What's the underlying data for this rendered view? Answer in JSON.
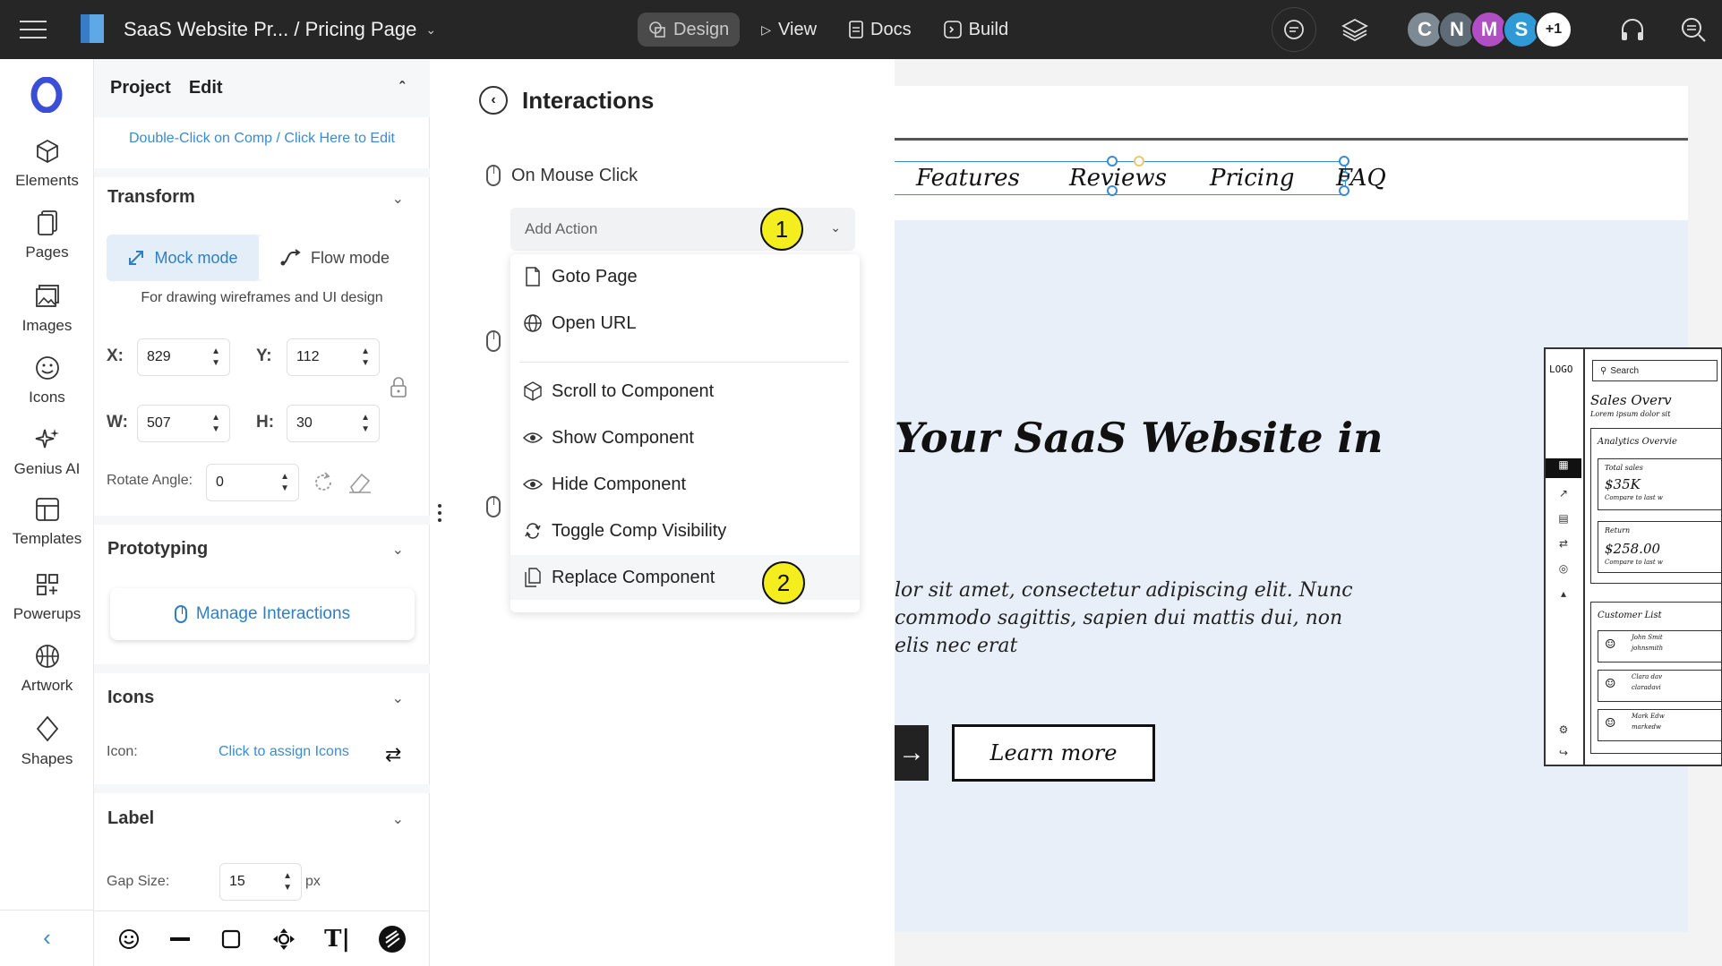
{
  "topbar": {
    "breadcrumb": "SaaS Website Pr... / Pricing Page",
    "nav": [
      "Design",
      "View",
      "Docs",
      "Build"
    ],
    "avatars": [
      {
        "letter": "C",
        "color": "#7d8a94"
      },
      {
        "letter": "N",
        "color": "#5f6b76"
      },
      {
        "letter": "M",
        "color": "#b04ec4"
      },
      {
        "letter": "S",
        "color": "#2f9ad6"
      }
    ],
    "avatar_more": "+1"
  },
  "rail": {
    "items": [
      "Elements",
      "Pages",
      "Images",
      "Icons",
      "Genius AI",
      "Templates",
      "Powerups",
      "Artwork",
      "Shapes"
    ]
  },
  "props": {
    "tabs": [
      "Project",
      "Edit"
    ],
    "hint": "Double-Click on Comp / Click Here to Edit",
    "transform": {
      "title": "Transform",
      "mock_mode": "Mock mode",
      "flow_mode": "Flow mode",
      "mode_desc": "For drawing wireframes and UI design",
      "x_label": "X:",
      "x": "829",
      "y_label": "Y:",
      "y": "112",
      "w_label": "W:",
      "w": "507",
      "h_label": "H:",
      "h": "30",
      "rotate_label": "Rotate Angle:",
      "rotate": "0"
    },
    "prototyping": {
      "title": "Prototyping",
      "manage": "Manage Interactions"
    },
    "icons": {
      "title": "Icons",
      "icon_label": "Icon:",
      "assign": "Click to assign Icons"
    },
    "label": {
      "title": "Label",
      "gap_label": "Gap Size:",
      "gap": "15",
      "unit": "px"
    }
  },
  "interactions": {
    "title": "Interactions",
    "event": "On Mouse Click",
    "add_action": "Add Action",
    "badge1": "1",
    "badge2": "2",
    "menu": [
      {
        "label": "Goto Page",
        "icon": "page-icon"
      },
      {
        "label": "Open URL",
        "icon": "globe-icon"
      },
      {
        "label": "Scroll to Component",
        "icon": "cube-icon"
      },
      {
        "label": "Show Component",
        "icon": "eye-icon"
      },
      {
        "label": "Hide Component",
        "icon": "eye-closed-icon"
      },
      {
        "label": "Toggle Comp Visibility",
        "icon": "refresh-icon"
      },
      {
        "label": "Replace Component",
        "icon": "replace-icon"
      }
    ]
  },
  "canvas": {
    "nav_links": [
      "Features",
      "Reviews",
      "Pricing",
      "FAQ"
    ],
    "hero_title": "Your SaaS Website in",
    "hero_lines": [
      "lor sit amet, consectetur adipiscing elit. Nunc",
      " commodo sagittis, sapien dui mattis dui, non",
      "elis nec erat"
    ],
    "learn_more": "Learn more",
    "mock": {
      "logo": "LOGO",
      "search": "Search",
      "sales": "Sales Overv",
      "lorem": "Lorem ipsum dolor sit",
      "analytics": "Analytics Overvie",
      "total_sales": "Total sales",
      "total_value": "$35K",
      "compare": "Compare to last w",
      "return": "Return",
      "return_value": "$258.00",
      "customers": "Customer List",
      "c1": "John Smit",
      "c1b": "johnsmith",
      "c2": "Clara dav",
      "c2b": "claradavi",
      "c3": "Mark Edw",
      "c3b": "markedw"
    }
  }
}
